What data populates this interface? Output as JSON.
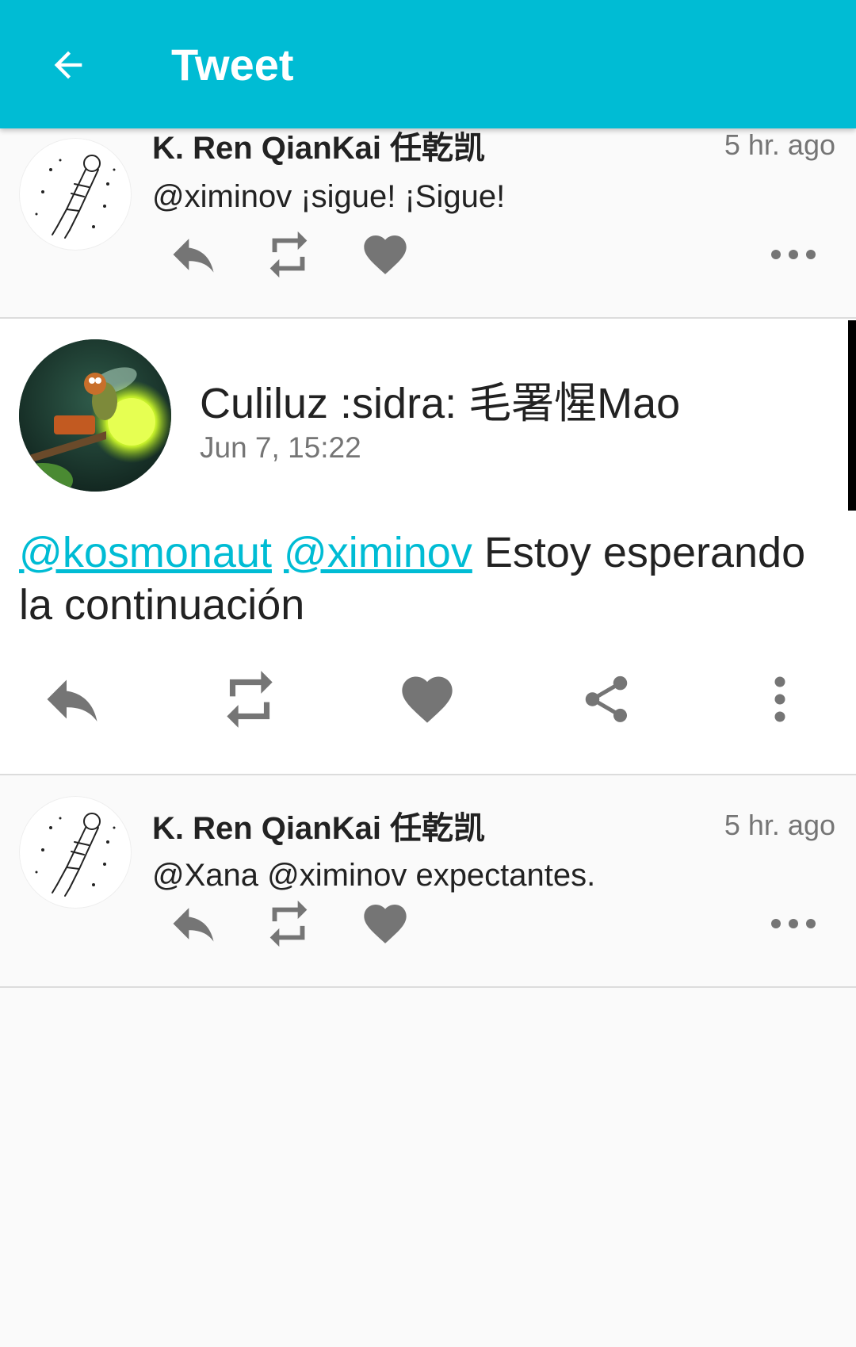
{
  "appbar": {
    "title": "Tweet",
    "back_icon": "arrow-back-icon",
    "color": "#00bcd4"
  },
  "reply_top": {
    "author": "K. Ren QianKai 任乾凯",
    "time": "5 hr. ago",
    "text": "@ximinov ¡sigue! ¡Sigue!",
    "avatar_icon": "astronaut-avatar"
  },
  "main_tweet": {
    "author": "Culiluz :sidra: 毛署惺Mao",
    "date": "Jun 7, 15:22",
    "mentions": [
      "@kosmonaut",
      "@ximinov"
    ],
    "text_after_mentions": " Estoy esperando la continuación",
    "avatar_icon": "firefly-avatar",
    "link_color": "#00bcd4"
  },
  "reply_bottom": {
    "author": "K. Ren QianKai 任乾凯",
    "time": "5 hr. ago",
    "text": "@Xana @ximinov expectantes.",
    "avatar_icon": "astronaut-avatar"
  },
  "icons": {
    "reply": "reply-icon",
    "retweet": "retweet-icon",
    "like": "heart-icon",
    "share": "share-icon",
    "more_horizontal": "more-horizontal-icon",
    "more_vertical": "more-vertical-icon",
    "icon_color": "#757575"
  }
}
